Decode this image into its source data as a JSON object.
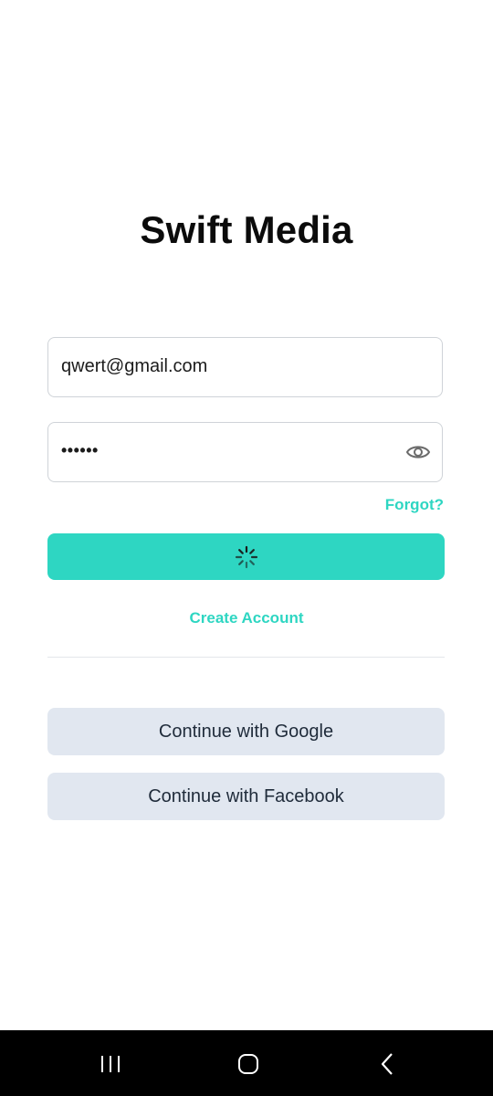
{
  "app": {
    "title": "Swift Media"
  },
  "login_form": {
    "email_value": "qwert@gmail.com",
    "password_value": "••••••",
    "forgot_label": "Forgot?",
    "submit_state": "loading",
    "create_account_label": "Create Account"
  },
  "social": {
    "google_label": "Continue with Google",
    "facebook_label": "Continue with Facebook"
  },
  "icons": {
    "password_toggle": "eye-icon",
    "spinner": "loading-spinner-icon",
    "nav_recent": "recent-apps-icon",
    "nav_home": "home-icon",
    "nav_back": "back-icon"
  },
  "colors": {
    "accent": "#2ed6c2",
    "social_button_bg": "#e1e7f0",
    "nav_bar_bg": "#000000"
  }
}
